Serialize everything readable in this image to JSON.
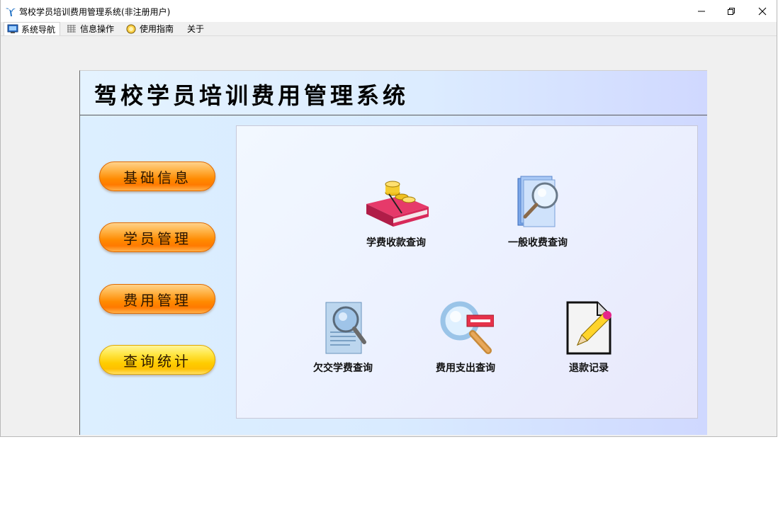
{
  "window": {
    "title": "驾校学员培训费用管理系统(非注册用户)"
  },
  "tabs": [
    {
      "label": "系统导航",
      "icon": "monitor-icon"
    },
    {
      "label": "信息操作",
      "icon": "grid-icon"
    },
    {
      "label": "使用指南",
      "icon": "guide-icon"
    },
    {
      "label": "关于"
    }
  ],
  "header": {
    "title": "驾校学员培训费用管理系统"
  },
  "nav": [
    "基础信息",
    "学员管理",
    "费用管理",
    "查询统计"
  ],
  "functions": [
    {
      "label": "学费收款查询",
      "icon": "money-book-icon"
    },
    {
      "label": "一般收费查询",
      "icon": "document-search-icon"
    },
    {
      "label": "欠交学费查询",
      "icon": "page-magnifier-icon"
    },
    {
      "label": "费用支出查询",
      "icon": "magnifier-minus-icon"
    },
    {
      "label": "退款记录",
      "icon": "pencil-note-icon"
    }
  ],
  "colors": {
    "nav_orange": "#ff8a00",
    "nav_yellow": "#ffcc00",
    "panel_bg": "#dcefff"
  }
}
